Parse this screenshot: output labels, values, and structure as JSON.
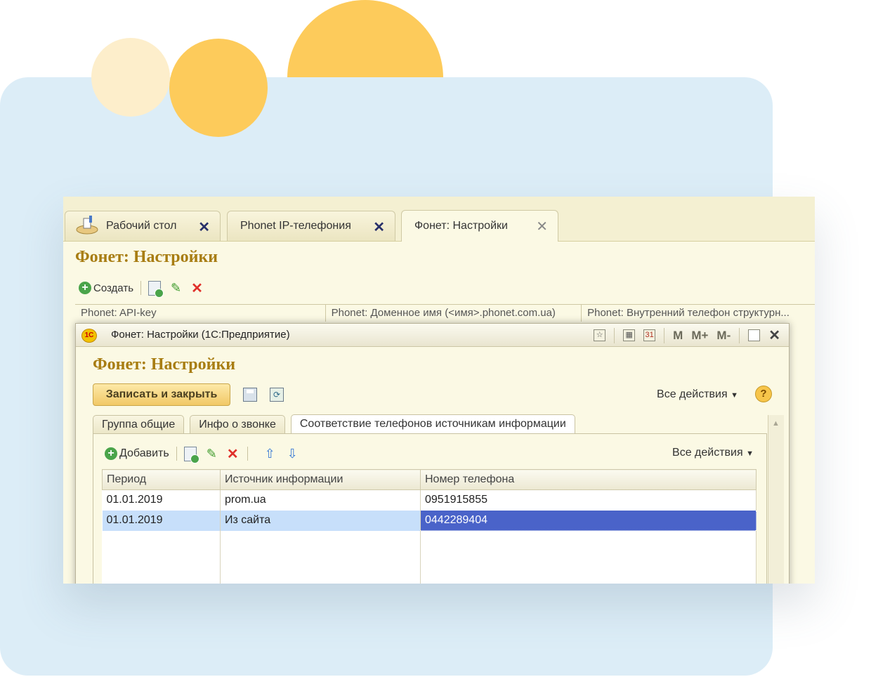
{
  "tabs": [
    {
      "label": "Рабочий стол"
    },
    {
      "label": "Phonet IP-телефония"
    },
    {
      "label": "Фонет: Настройки"
    }
  ],
  "page": {
    "title": "Фонет: Настройки"
  },
  "toolbar": {
    "create_label": "Создать"
  },
  "list_columns": [
    "Phonet: API-key",
    "Phonet: Доменное имя (<имя>.phonet.com.ua)",
    "Phonet: Внутренний телефон структурн..."
  ],
  "modal": {
    "window_title": "Фонет: Настройки  (1С:Предприятие)",
    "heading": "Фонет: Настройки",
    "save_close_label": "Записать и закрыть",
    "all_actions_label": "Все действия",
    "help_label": "?",
    "tool_letters": [
      "M",
      "M+",
      "M-"
    ],
    "tabs": [
      {
        "label": "Группа общие"
      },
      {
        "label": "Инфо о звонке"
      },
      {
        "label": "Соответствие телефонов источникам информации"
      }
    ],
    "panel": {
      "add_label": "Добавить",
      "all_actions_label": "Все действия",
      "columns": [
        "Период",
        "Источник информации",
        "Номер телефона"
      ],
      "rows": [
        {
          "period": "01.01.2019",
          "source": "prom.ua",
          "phone": "0951915855"
        },
        {
          "period": "01.01.2019",
          "source": "Из сайта",
          "phone": "0442289404"
        }
      ]
    }
  },
  "colors": {
    "title_gold": "#a87d12",
    "selection_row": "#c7dffa",
    "selection_cell": "#4a63c9",
    "background_card": "#dcedf7",
    "accent_yellow": "#fdcb5b"
  }
}
